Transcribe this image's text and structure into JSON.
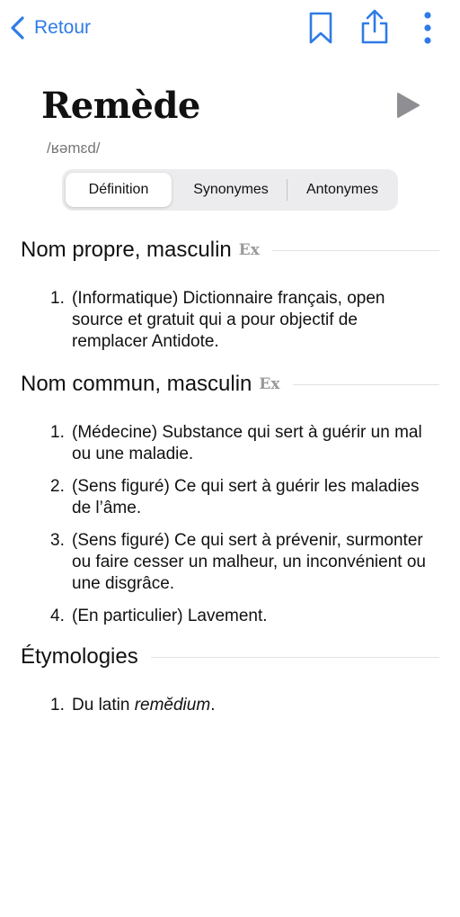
{
  "nav": {
    "back_label": "Retour"
  },
  "icons": {
    "back": "chevron-left-icon",
    "bookmark": "bookmark-icon",
    "share": "share-icon",
    "more": "more-vertical-icon",
    "play": "play-icon"
  },
  "colors": {
    "accent": "#2f7be6",
    "play": "#8e8e93"
  },
  "entry": {
    "word": "Remède",
    "phonetic": "/ʁəmɛd/"
  },
  "tabs": [
    {
      "label": "Définition",
      "active": true
    },
    {
      "label": "Synonymes",
      "active": false
    },
    {
      "label": "Antonymes",
      "active": false
    }
  ],
  "sections": [
    {
      "title": "Nom propre, masculin",
      "ex": "Ex",
      "items": [
        "(Informatique) Dictionnaire français, open source et gratuit qui a pour objectif de remplacer Antidote."
      ]
    },
    {
      "title": "Nom commun, masculin",
      "ex": "Ex",
      "items": [
        "(Médecine) Substance qui sert à guérir un mal ou une maladie.",
        "(Sens figuré) Ce qui sert à guérir les maladies de l’âme.",
        "(Sens figuré) Ce qui sert à prévenir, surmonter ou faire cesser un malheur, un inconvénient ou une disgrâce.",
        "(En particulier) Lavement."
      ]
    },
    {
      "title": "Étymologies",
      "items_prefix": "Du latin ",
      "items_italic": "remĕdium",
      "items_suffix": "."
    }
  ]
}
